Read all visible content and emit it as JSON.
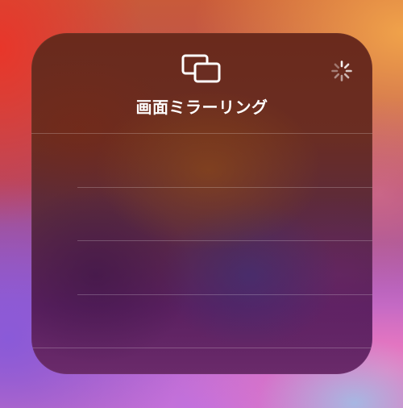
{
  "panel": {
    "title": "画面ミラーリング",
    "header_icon": "screen-mirroring-icon",
    "status_icon": "loading-spinner-icon"
  },
  "device_list": {
    "rows": [
      "",
      "",
      "",
      ""
    ]
  },
  "colors": {
    "panel_text": "#ffffff",
    "divider": "rgba(255,255,255,0.22)"
  }
}
